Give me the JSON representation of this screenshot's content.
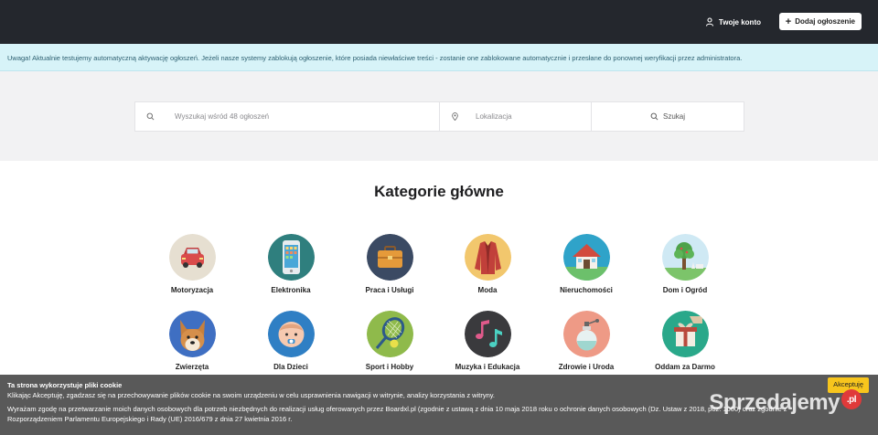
{
  "header": {
    "account_label": "Twoje konto",
    "add_label": "Dodaj ogłoszenie",
    "add_icon": "+"
  },
  "alert": {
    "text": "Uwaga! Aktualnie testujemy automatyczną aktywację ogłoszeń. Jeżeli nasze systemy zablokują ogłoszenie, które posiada niewłaściwe treści - zostanie one zablokowane automatycznie i przesłane do ponownej weryfikacji przez administratora."
  },
  "search": {
    "query_placeholder": "Wyszukaj wśród 48 ogłoszeń",
    "location_placeholder": "Lokalizacja",
    "button_label": "Szukaj"
  },
  "categories": {
    "title": "Kategorie główne",
    "items": [
      {
        "label": "Motoryzacja"
      },
      {
        "label": "Elektronika"
      },
      {
        "label": "Praca i Usługi"
      },
      {
        "label": "Moda"
      },
      {
        "label": "Nieruchomości"
      },
      {
        "label": "Dom i Ogród"
      },
      {
        "label": "Zwierzęta"
      },
      {
        "label": "Dla Dzieci"
      },
      {
        "label": "Sport i Hobby"
      },
      {
        "label": "Muzyka i Edukacja"
      },
      {
        "label": "Zdrowie i Uroda"
      },
      {
        "label": "Oddam za Darmo"
      }
    ]
  },
  "cookie": {
    "title": "Ta strona wykorzystuje pliki cookie",
    "line1": "Klikając Akceptuję, zgadzasz się na przechowywanie plików cookie na swoim urządzeniu w celu usprawnienia nawigacji w witrynie, analizy korzystania z witryny.",
    "line2": "Wyrażam zgodę na przetwarzanie moich danych osobowych dla potrzeb niezbędnych do realizacji usług oferowanych przez Boardxl.pl (zgodnie z ustawą z dnia 10 maja 2018 roku o ochronie danych osobowych (Dz. Ustaw z 2018, poz. 1000) oraz zgodnie z",
    "line3": "Rozporządzeniem Parlamentu Europejskiego i Rady (UE) 2016/679 z dnia 27 kwietnia 2016 r.",
    "accept_label": "Akceptuję"
  },
  "watermark": {
    "text": "Sprzedajemy",
    "suffix": ".pl"
  }
}
